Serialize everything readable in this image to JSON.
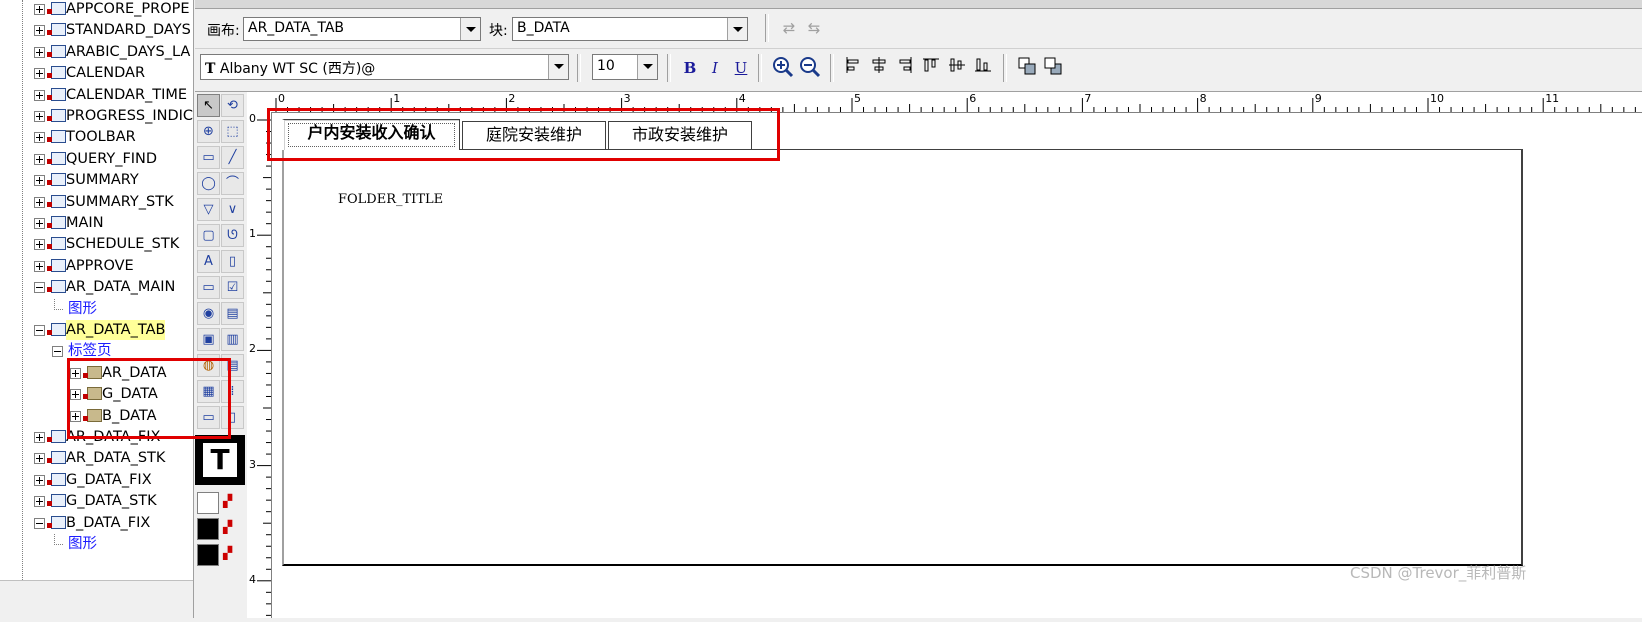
{
  "tree": {
    "items": [
      {
        "label": "APPCORE_PROPE",
        "expander": "plus"
      },
      {
        "label": "STANDARD_DAYS",
        "expander": "plus"
      },
      {
        "label": "ARABIC_DAYS_LA",
        "expander": "plus"
      },
      {
        "label": "CALENDAR",
        "expander": "plus"
      },
      {
        "label": "CALENDAR_TIME",
        "expander": "plus"
      },
      {
        "label": "PROGRESS_INDIC",
        "expander": "plus"
      },
      {
        "label": "TOOLBAR",
        "expander": "plus"
      },
      {
        "label": "QUERY_FIND",
        "expander": "plus"
      },
      {
        "label": "SUMMARY",
        "expander": "plus"
      },
      {
        "label": "SUMMARY_STK",
        "expander": "plus"
      },
      {
        "label": "MAIN",
        "expander": "plus"
      },
      {
        "label": "SCHEDULE_STK",
        "expander": "plus"
      },
      {
        "label": "APPROVE",
        "expander": "plus"
      },
      {
        "label": "AR_DATA_MAIN",
        "expander": "minus"
      },
      {
        "label": "图形",
        "expander": "none"
      },
      {
        "label": "AR_DATA_TAB",
        "expander": "minus"
      },
      {
        "label": "标签页",
        "expander": "minus"
      },
      {
        "label": "AR_DATA",
        "expander": "plus"
      },
      {
        "label": "G_DATA",
        "expander": "plus"
      },
      {
        "label": "B_DATA",
        "expander": "plus"
      },
      {
        "label": "AR_DATA_FIX",
        "expander": "plus"
      },
      {
        "label": "AR_DATA_STK",
        "expander": "plus"
      },
      {
        "label": "G_DATA_FIX",
        "expander": "plus"
      },
      {
        "label": "G_DATA_STK",
        "expander": "plus"
      },
      {
        "label": "B_DATA_FIX",
        "expander": "minus"
      },
      {
        "label": "图形",
        "expander": "none"
      }
    ]
  },
  "toolbar": {
    "canvas_label": "画布:",
    "canvas_value": "AR_DATA_TAB",
    "block_label": "块:",
    "block_value": "B_DATA",
    "font_value": "Albany WT SC (西方)@",
    "font_icon": "T",
    "size_value": "10",
    "bold": "B",
    "italic": "I",
    "underline": "U"
  },
  "ruler": {
    "h_numbers": [
      "0",
      "1",
      "2",
      "3",
      "4",
      "5",
      "6",
      "7",
      "8",
      "9",
      "10",
      "11"
    ],
    "v_numbers": [
      "0",
      "1",
      "2",
      "3",
      "4"
    ]
  },
  "canvas": {
    "tabs": [
      "户内安装收入确认",
      "庭院安装维护",
      "市政安装维护"
    ],
    "folder_title": "FOLDER_TITLE"
  },
  "palette": {
    "text_tool": "T"
  },
  "watermark": "CSDN @Trevor_菲利普斯",
  "colors": {
    "highlight_box": "#e00000",
    "selected_node_bg": "#ffff99",
    "link_blue": "#1c1cff"
  }
}
